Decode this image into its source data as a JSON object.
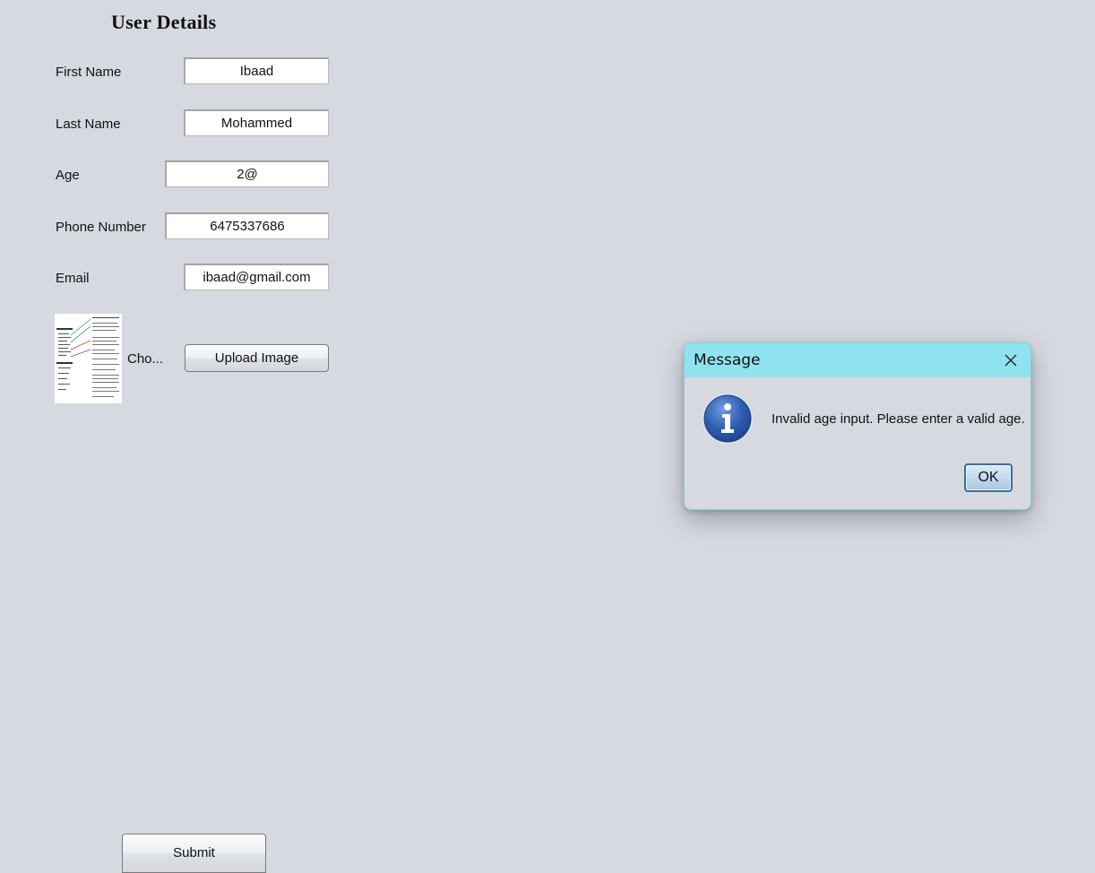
{
  "form": {
    "title": "User Details",
    "fields": [
      {
        "label": "First Name",
        "value": "Ibaad"
      },
      {
        "label": "Last Name",
        "value": "Mohammed"
      },
      {
        "label": "Age",
        "value": "2@"
      },
      {
        "label": "Phone Number",
        "value": "6475337686"
      },
      {
        "label": "Email",
        "value": "ibaad@gmail.com"
      }
    ],
    "image": {
      "chosen_text": "Cho...",
      "upload_button": "Upload Image"
    },
    "submit_button": "Submit"
  },
  "dialog": {
    "title": "Message",
    "message": "Invalid age input. Please enter a valid age.",
    "ok_button": "OK",
    "icon": "info-icon",
    "close_icon": "close-icon"
  },
  "colors": {
    "background": "#d6d9e0",
    "dialog_titlebar": "#8fe3ee",
    "info_icon": "#2f5fb3"
  }
}
